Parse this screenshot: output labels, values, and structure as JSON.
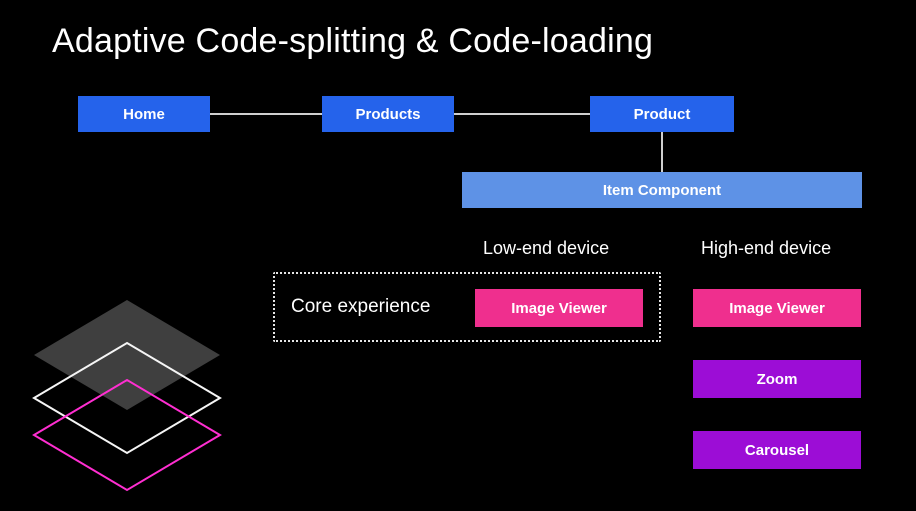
{
  "title": "Adaptive Code-splitting & Code-loading",
  "nav": {
    "home": "Home",
    "products": "Products",
    "product": "Product"
  },
  "component": "Item Component",
  "columns": {
    "low": "Low-end device",
    "high": "High-end device"
  },
  "core_label": "Core experience",
  "modules": {
    "low_viewer": "Image Viewer",
    "high_viewer": "Image Viewer",
    "zoom": "Zoom",
    "carousel": "Carousel"
  }
}
